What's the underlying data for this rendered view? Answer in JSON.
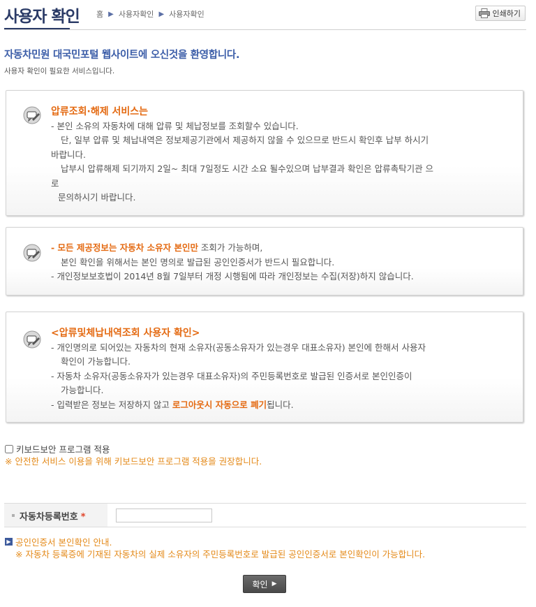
{
  "header": {
    "title": "사용자 확인",
    "breadcrumb": [
      "홈",
      "사용자확인",
      "사용자확인"
    ],
    "print_label": "인쇄하기"
  },
  "welcome": {
    "headline": "자동차민원 대국민포털 웹사이트에 오신것을 환영합니다.",
    "subline": "사용자 확인이 필요한 서비스입니다."
  },
  "box1": {
    "title": "압류조회·해제 서비스는",
    "lines": [
      "- 본인 소유의 자동차에 대해 압류 및 체납정보를 조회할수 있습니다.",
      "단, 일부 압류 및 체납내역은 정보제공기관에서 제공하지 않을 수 있으므로 반드시 확인후 납부 하시기",
      "바랍니다.",
      "납부시 압류해제 되기까지 2일~ 최대 7일정도 시간 소요 될수있으며 납부결과 확인은 압류촉탁기관 으",
      "로",
      "문의하시기 바랍니다."
    ]
  },
  "box2": {
    "hl_part": "- 모든 제공정보는 자동차 소유자 본인만",
    "rest_part": " 조회가 가능하며,",
    "lines": [
      "본인 확인을 위해서는 본인 명의로 발급된 공인인증서가 반드시 필요합니다.",
      "- 개인정보보호법이 2014년 8월 7일부터 개정 시행됨에 따라 개인정보는 수집(저장)하지 않습니다."
    ]
  },
  "box3": {
    "title": "<압류및체납내역조회 사용자 확인>",
    "lines": [
      "- 개인명의로 되어있는 자동차의 현재 소유자(공동소유자가 있는경우 대표소유자) 본인에 한해서 사용자",
      "확인이 가능합니다.",
      "- 자동차 소유자(공동소유자가 있는경우 대표소유자)의 주민등록번호로 발급된 인증서로 본인인증이",
      "가능합니다."
    ],
    "last_pre": "- 입력받은 정보는 저장하지 않고 ",
    "last_hl": "로그아웃시 자동으로 폐기",
    "last_post": "됩니다."
  },
  "keyboard": {
    "checkbox_label": "키보드보안 프로그램 적용",
    "checked": false,
    "note": "※ 안전한 서비스 이용을 위해 키보드보안 프로그램 적용을 권장합니다."
  },
  "form": {
    "label": "자동차등록번호",
    "required_mark": "*",
    "value": "",
    "placeholder": ""
  },
  "cert": {
    "title": "공인인증서 본인확인 안내.",
    "note": "※ 자동차 등록증에 기재된 자동차의 실제 소유자의 주민등록번호로 발급된 공인인증서로 본인확인이 가능합니다."
  },
  "confirm_label": "확인",
  "colors": {
    "title_navy": "#2a3a66",
    "welcome_blue": "#3b5da8",
    "highlight_orange": "#e46a12",
    "note_orange": "#e48a1a",
    "required_red": "#e0452a"
  },
  "icons": {
    "box_icon": "speech-bubble-pencil-icon",
    "print_icon": "printer-icon",
    "info_icon": "info-square-icon",
    "arrow": "chevron-right-icon"
  }
}
